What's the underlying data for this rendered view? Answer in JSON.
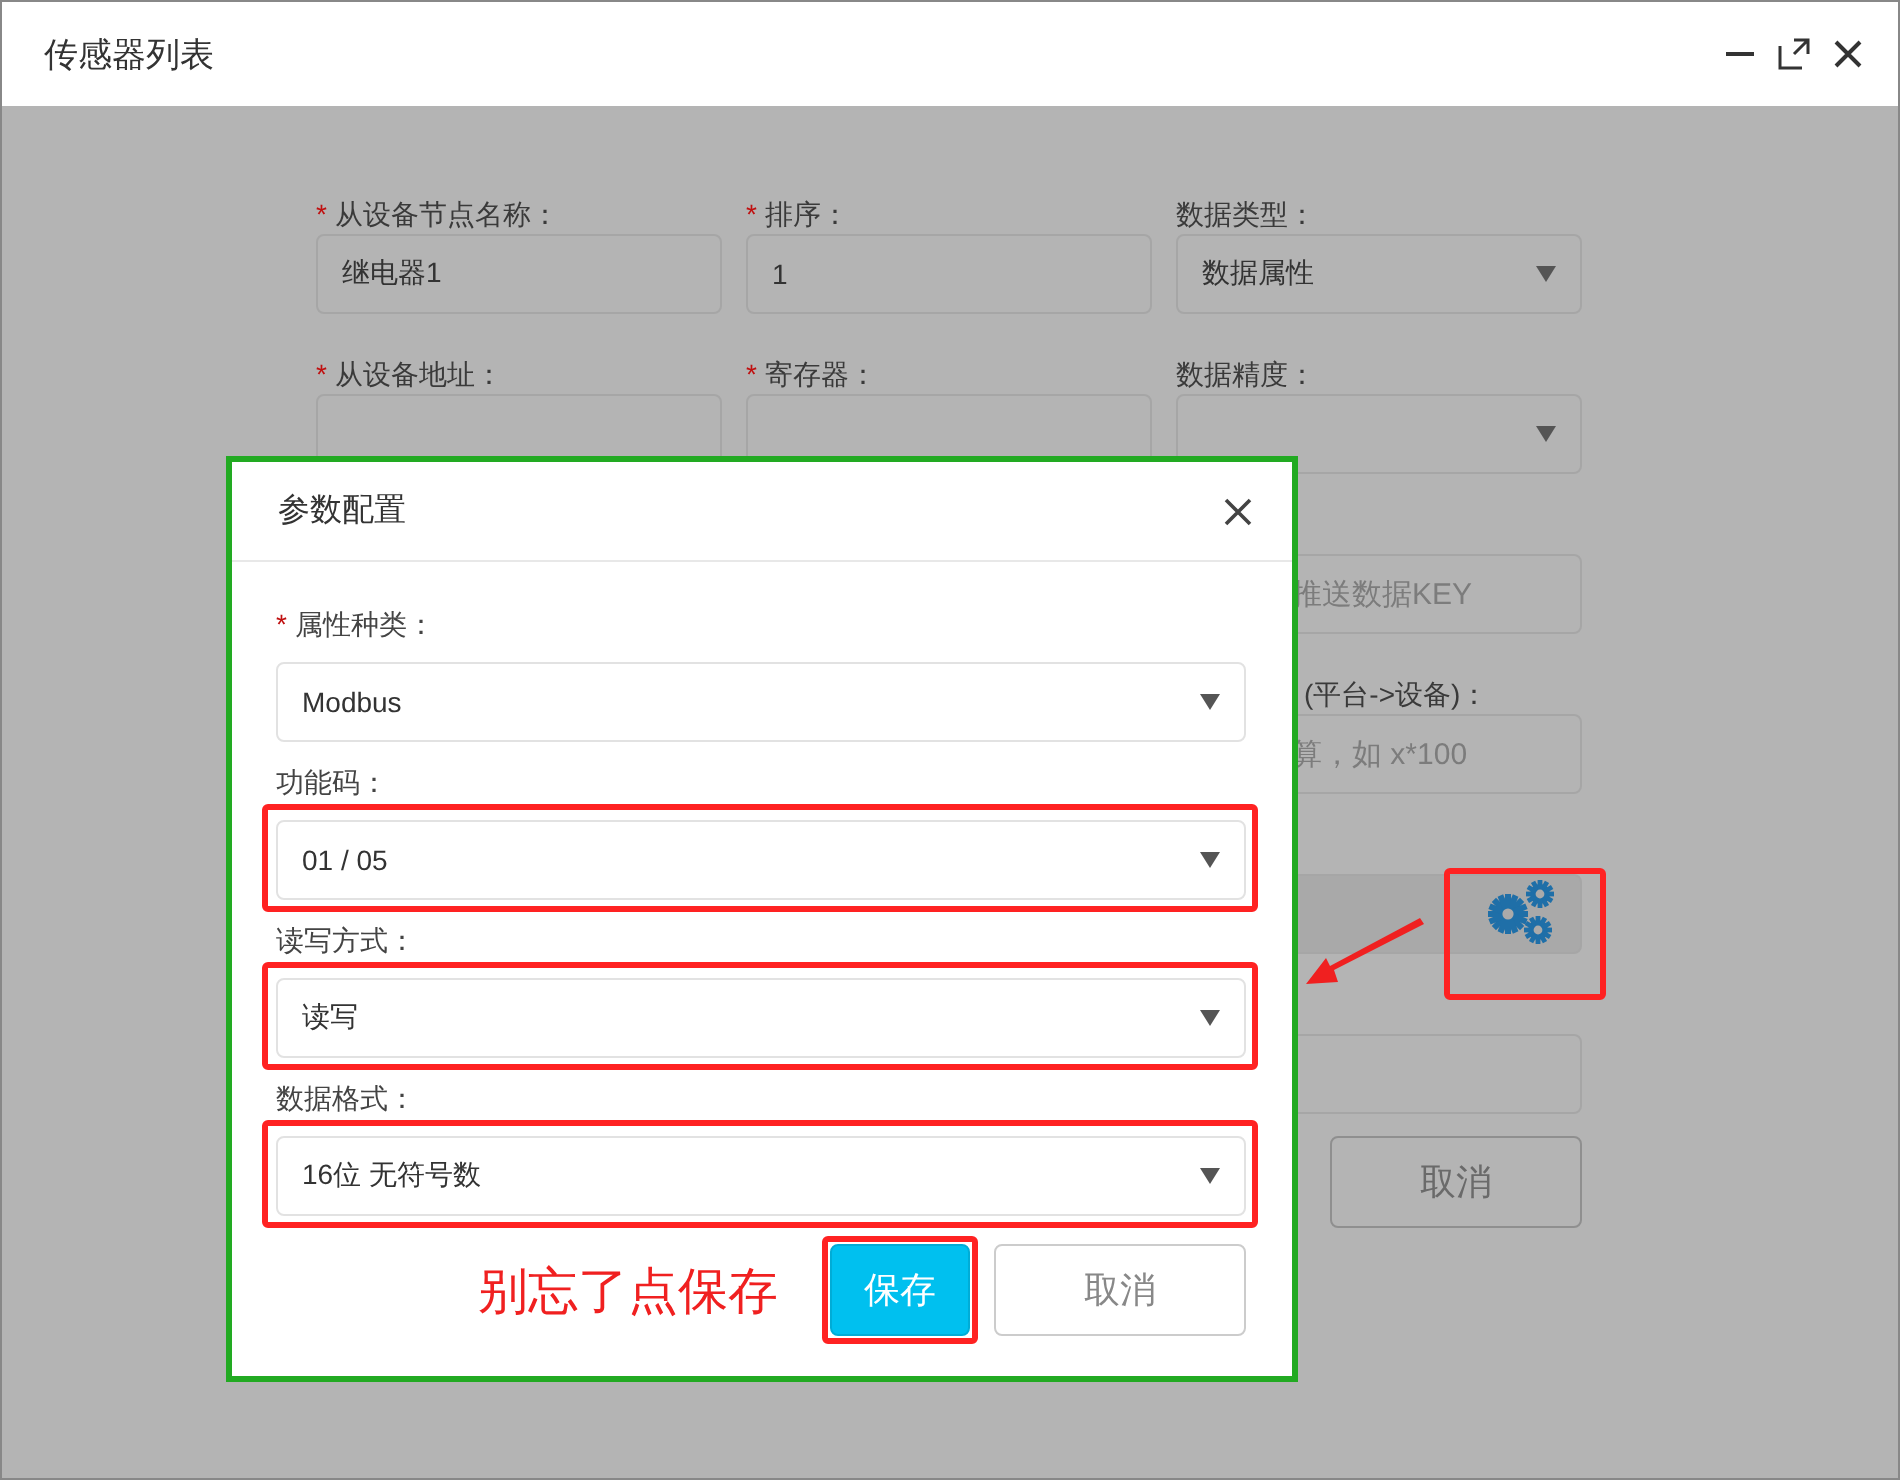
{
  "window": {
    "title": "传感器列表"
  },
  "form": {
    "columns": [
      {
        "groups": [
          {
            "label": "从设备节点名称：",
            "required_mark": "*",
            "control": {
              "kind": "input",
              "value": "继电器1"
            }
          },
          {
            "label": "从设备地址：",
            "required_mark": "*",
            "control": {
              "kind": "input"
            }
          }
        ]
      },
      {
        "groups": [
          {
            "label": "排序：",
            "required_mark": "*",
            "control": {
              "kind": "input",
              "value": "1"
            }
          },
          {
            "label": "寄存器：",
            "required_mark": "*",
            "control": {
              "kind": "input"
            }
          }
        ]
      },
      {
        "groups": [
          {
            "label": "数据类型：",
            "control": {
              "kind": "select",
              "value": "数据属性"
            }
          },
          {
            "label": "数据精度：",
            "control": {
              "kind": "select"
            }
          },
          {
            "control": {
              "kind": "clipped-input",
              "placeholder": "推送数据KEY"
            }
          },
          {
            "label": "(平台->设备)：",
            "kind": "clipped",
            "control": {
              "kind": "clipped-input",
              "placeholder": "算，如 x*100"
            }
          },
          {
            "control": {
              "kind": "gear",
              "highlighted": true
            }
          },
          {
            "control": {
              "kind": "input"
            }
          },
          {
            "control": {
              "kind": "button",
              "label": "取消"
            }
          }
        ]
      }
    ]
  },
  "dialog": {
    "title": "参数配置",
    "fields": [
      {
        "label": "属性种类：",
        "required_mark": "*",
        "value": "Modbus",
        "highlighted": false
      },
      {
        "label": "功能码：",
        "value": "01 / 05",
        "highlighted": true
      },
      {
        "label": "读写方式：",
        "value": "读写",
        "highlighted": true
      },
      {
        "label": "数据格式：",
        "value": "16位 无符号数",
        "highlighted": true
      }
    ],
    "note": "别忘了点保存",
    "buttons": [
      {
        "label": "保存",
        "kind": "primary",
        "highlighted": true
      },
      {
        "label": "取消",
        "kind": "default",
        "highlighted": false
      }
    ]
  }
}
